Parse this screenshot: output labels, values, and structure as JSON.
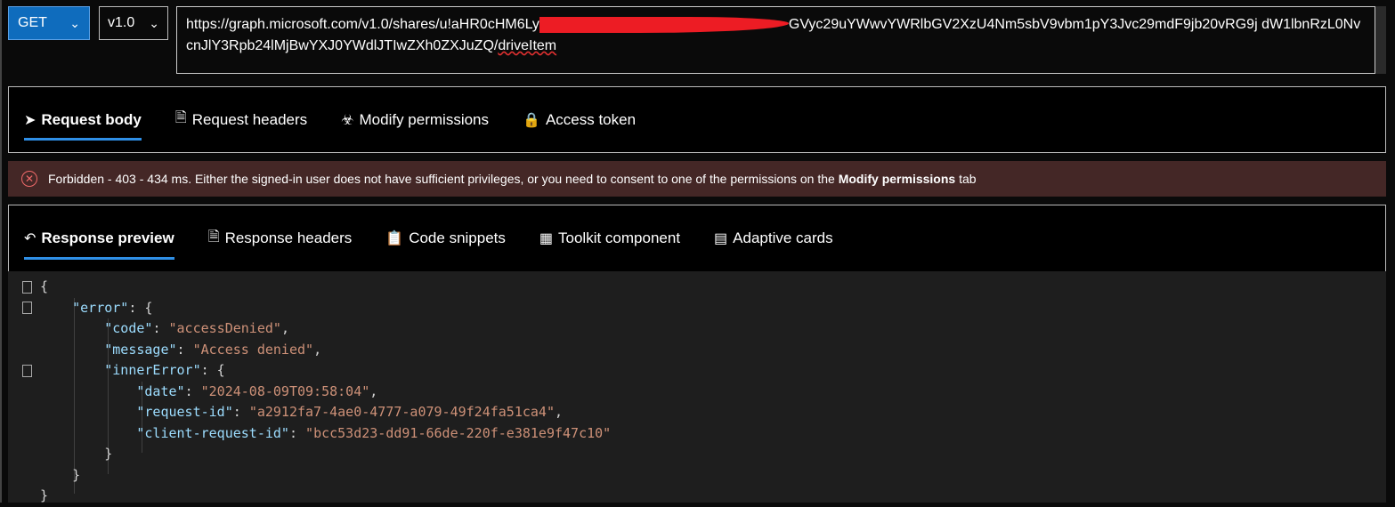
{
  "request": {
    "method": "GET",
    "version": "v1.0",
    "url_visible_start": "https://graph.microsoft.com/v1.0/shares/u!aHR0cHM6Ly",
    "url_visible_end_line1": "GVyc29uYWwvYWRlbGV2XzU4Nm5sbV9vbm1pY3Jvc29mdF9jb20vRG9j",
    "url_line2": "dW1lbnRzL0NvcnJlY3Rpb24lMjBwYXJ0YWdlJTIwZXh0ZXJuZQ/",
    "url_tail": "driveItem"
  },
  "request_tabs": [
    {
      "label": "Request body",
      "icon": "send-icon",
      "active": true
    },
    {
      "label": "Request headers",
      "icon": "document-icon"
    },
    {
      "label": "Modify permissions",
      "icon": "permission-icon"
    },
    {
      "label": "Access token",
      "icon": "lock-icon"
    }
  ],
  "status": {
    "text": "Forbidden - 403 - 434 ms. Either the signed-in user does not have sufficient privileges, or you need to consent to one of the permissions on the ",
    "bold": "Modify permissions",
    "suffix": " tab",
    "color": "#442726"
  },
  "response_tabs": [
    {
      "label": "Response preview",
      "icon": "undo-icon",
      "active": true
    },
    {
      "label": "Response headers",
      "icon": "document-icon"
    },
    {
      "label": "Code snippets",
      "icon": "clipboard-code-icon"
    },
    {
      "label": "Toolkit component",
      "icon": "toolkit-icon"
    },
    {
      "label": "Adaptive cards",
      "icon": "card-icon"
    }
  ],
  "response": {
    "code": "accessDenied",
    "message": "Access denied",
    "date": "2024-08-09T09:58:04",
    "request_id": "a2912fa7-4ae0-4777-a079-49f24fa51ca4",
    "client_request_id": "bcc53d23-dd91-66de-220f-e381e9f47c10"
  }
}
